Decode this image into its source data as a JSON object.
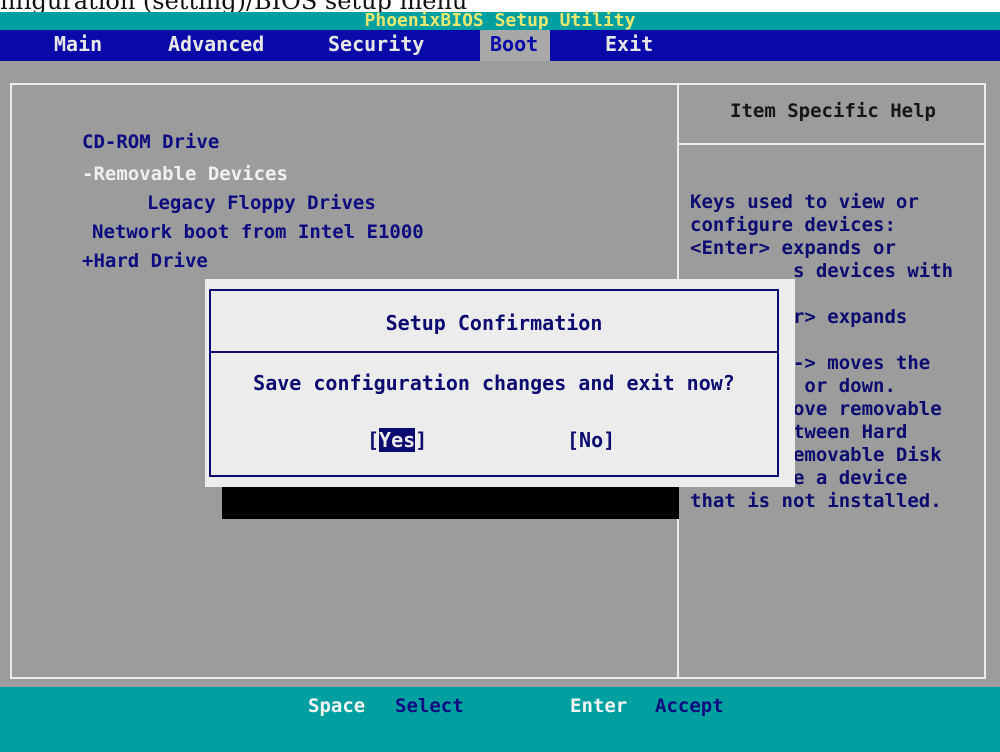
{
  "caption_fragment": "nfiguration (setting)/BIOS setup menu",
  "window": {
    "title": "PhoenixBIOS Setup Utility"
  },
  "menu": [
    {
      "label": "Main"
    },
    {
      "label": "Advanced"
    },
    {
      "label": "Security"
    },
    {
      "label": "Boot",
      "active": true
    },
    {
      "label": "Exit"
    }
  ],
  "boot_list": [
    {
      "label": "CD-ROM Drive"
    },
    {
      "label": "-Removable Devices"
    },
    {
      "label": "Legacy Floppy Drives"
    },
    {
      "label": "Network boot from Intel E1000"
    },
    {
      "label": "+Hard Drive"
    }
  ],
  "help": {
    "title": "Item Specific Help",
    "text": "Keys used to view or\nconfigure devices:\n<Enter> expands or\n         s devices with\n\n        er> expands\n\n        <-> moves the\n        p or down.\n         ove removable\ndevice between Hard\nDisk or Removable Disk\n<d> Remove a device\nthat is not installed."
  },
  "dialog": {
    "title": "Setup Confirmation",
    "message": "Save configuration changes and exit now?",
    "yes": {
      "bracket_open": "[",
      "first": "Y",
      "rest": "es",
      "bracket_close": "]"
    },
    "no": "[No]"
  },
  "status": [
    {
      "key": "Space",
      "action": "Select"
    },
    {
      "key": "Enter",
      "action": "Accept"
    }
  ],
  "colors": {
    "menubar_bg": "#0a0aa8",
    "titlebar_bg": "#00a0a0",
    "panel_bg": "#9c9c9c",
    "dialog_bg": "#ececec",
    "text_blue": "#0c0c70"
  }
}
